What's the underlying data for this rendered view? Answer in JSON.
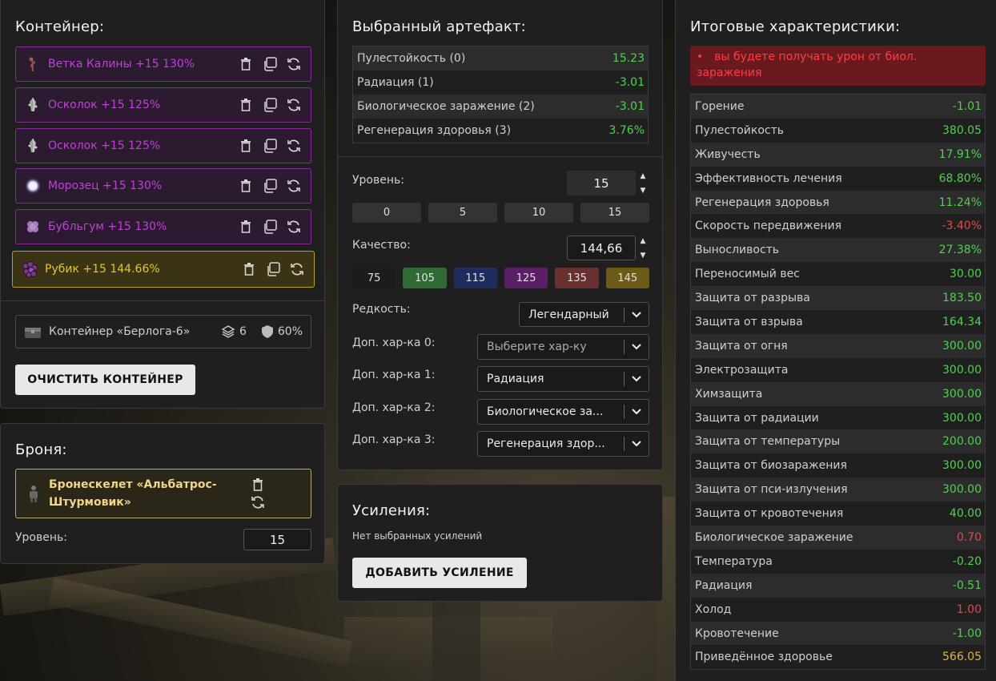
{
  "container": {
    "title": "Контейнер:",
    "items": [
      {
        "label": "Ветка Калины +15 130%",
        "icon": "viburnum-branch-icon"
      },
      {
        "label": "Осколок +15 125%",
        "icon": "shard-icon"
      },
      {
        "label": "Осколок +15 125%",
        "icon": "shard-icon"
      },
      {
        "label": "Морозец +15 130%",
        "icon": "frost-icon"
      },
      {
        "label": "Бубльгум +15 130%",
        "icon": "bubblegum-icon"
      },
      {
        "label": "Рубик +15 144.66%",
        "icon": "rubik-icon"
      }
    ],
    "box": {
      "label": "Контейнер «Берлога-6»",
      "slots": "6",
      "protection": "60%"
    },
    "clear_button": "ОЧИСТИТЬ КОНТЕЙНЕР",
    "colors": {
      "epic": "#c040d8",
      "legendary": "#e3c531"
    }
  },
  "armor": {
    "title": "Броня:",
    "item": "Бронескелет «Альбатрос-Штурмовик»",
    "level_label": "Уровень:",
    "level_value": "15"
  },
  "artifact": {
    "title": "Выбранный артефакт:",
    "stats": [
      {
        "name": "Пулестойкость (0)",
        "value": "15.23",
        "tone": "green"
      },
      {
        "name": "Радиация (1)",
        "value": "-3.01",
        "tone": "green"
      },
      {
        "name": "Биологическое заражение (2)",
        "value": "-3.01",
        "tone": "green"
      },
      {
        "name": "Регенерация здоровья (3)",
        "value": "3.76%",
        "tone": "green"
      }
    ],
    "level_label": "Уровень:",
    "level_value": "15",
    "level_presets": [
      "0",
      "5",
      "10",
      "15"
    ],
    "quality_label": "Качество:",
    "quality_value": "144,66",
    "quality_presets": [
      {
        "label": "75",
        "color": "#1c1c1c"
      },
      {
        "label": "105",
        "color": "#2f6b35"
      },
      {
        "label": "115",
        "color": "#1f2c5e"
      },
      {
        "label": "125",
        "color": "#5a1f66"
      },
      {
        "label": "135",
        "color": "#6a3030"
      },
      {
        "label": "145",
        "color": "#6b5a18"
      }
    ],
    "rarity_label": "Редкость:",
    "rarity_value": "Легендарный",
    "extra": [
      {
        "label": "Доп. хар-ка 0:",
        "value": "Выберите хар-ку",
        "placeholder": true
      },
      {
        "label": "Доп. хар-ка 1:",
        "value": "Радиация",
        "placeholder": false
      },
      {
        "label": "Доп. хар-ка 2:",
        "value": "Биологическое за...",
        "placeholder": false
      },
      {
        "label": "Доп. хар-ка 3:",
        "value": "Регенерация здор...",
        "placeholder": false
      }
    ]
  },
  "boosts": {
    "title": "Усиления:",
    "empty": "Нет выбранных усилений",
    "add_button": "ДОБАВИТЬ УСИЛЕНИЕ"
  },
  "totals": {
    "title": "Итоговые характеристики:",
    "warning": "вы будете получать урон от биол. заражения",
    "stats": [
      {
        "name": "Горение",
        "value": "-1.01",
        "tone": "green"
      },
      {
        "name": "Пулестойкость",
        "value": "380.05",
        "tone": "green"
      },
      {
        "name": "Живучесть",
        "value": "17.91%",
        "tone": "green"
      },
      {
        "name": "Эффективность лечения",
        "value": "68.80%",
        "tone": "green"
      },
      {
        "name": "Регенерация здоровья",
        "value": "11.24%",
        "tone": "green"
      },
      {
        "name": "Скорость передвижения",
        "value": "-3.40%",
        "tone": "red"
      },
      {
        "name": "Выносливость",
        "value": "27.38%",
        "tone": "green"
      },
      {
        "name": "Переносимый вес",
        "value": "30.00",
        "tone": "green"
      },
      {
        "name": "Защита от разрыва",
        "value": "183.50",
        "tone": "green"
      },
      {
        "name": "Защита от взрыва",
        "value": "164.34",
        "tone": "green"
      },
      {
        "name": "Защита от огня",
        "value": "300.00",
        "tone": "green"
      },
      {
        "name": "Электрозащита",
        "value": "300.00",
        "tone": "green"
      },
      {
        "name": "Химзащита",
        "value": "300.00",
        "tone": "green"
      },
      {
        "name": "Защита от радиации",
        "value": "300.00",
        "tone": "green"
      },
      {
        "name": "Защита от температуры",
        "value": "200.00",
        "tone": "green"
      },
      {
        "name": "Защита от биозаражения",
        "value": "300.00",
        "tone": "green"
      },
      {
        "name": "Защита от пси-излучения",
        "value": "300.00",
        "tone": "green"
      },
      {
        "name": "Защита от кровотечения",
        "value": "40.00",
        "tone": "green"
      },
      {
        "name": "Биологическое заражение",
        "value": "0.70",
        "tone": "red"
      },
      {
        "name": "Температура",
        "value": "-0.20",
        "tone": "green"
      },
      {
        "name": "Радиация",
        "value": "-0.51",
        "tone": "green"
      },
      {
        "name": "Холод",
        "value": "1.00",
        "tone": "red"
      },
      {
        "name": "Кровотечение",
        "value": "-1.00",
        "tone": "green"
      },
      {
        "name": "Приведённое здоровье",
        "value": "566.05",
        "tone": "gold"
      }
    ]
  }
}
